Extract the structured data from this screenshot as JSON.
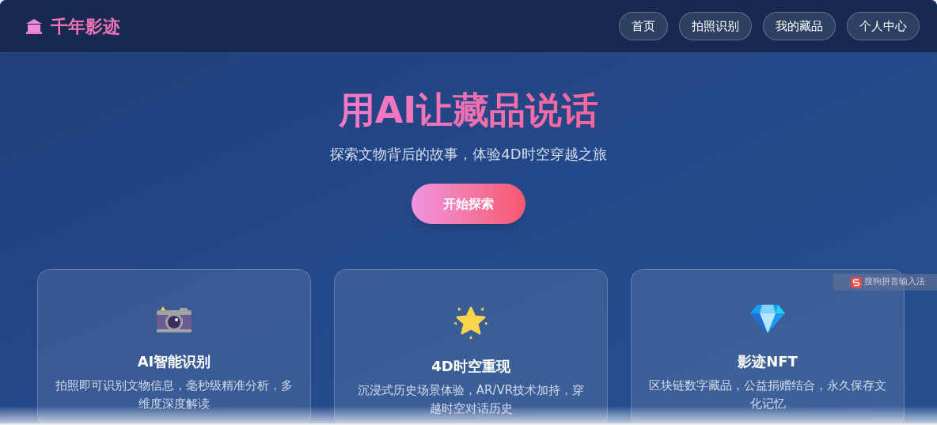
{
  "header": {
    "logo": "千年影迹",
    "nav": [
      {
        "label": "首页"
      },
      {
        "label": "拍照识别"
      },
      {
        "label": "我的藏品"
      },
      {
        "label": "个人中心"
      }
    ]
  },
  "hero": {
    "title": "用AI让藏品说话",
    "subtitle": "探索文物背后的故事，体验4D时空穿越之旅",
    "button": "开始探索"
  },
  "features": [
    {
      "kind": "camera",
      "title": "AI智能识别",
      "description": "拍照即可识别文物信息，毫秒级精准分析，多维度深度解读"
    },
    {
      "kind": "star",
      "title": "4D时空重现",
      "description": "沉浸式历史场景体验，AR/VR技术加持，穿越时空对话历史"
    },
    {
      "kind": "gem",
      "title": "影迹NFT",
      "description": "区块链数字藏品，公益捐赠结合，永久保存文化记忆"
    }
  ],
  "ime_toolbar": {
    "label": "搜狗拼音输入法"
  }
}
